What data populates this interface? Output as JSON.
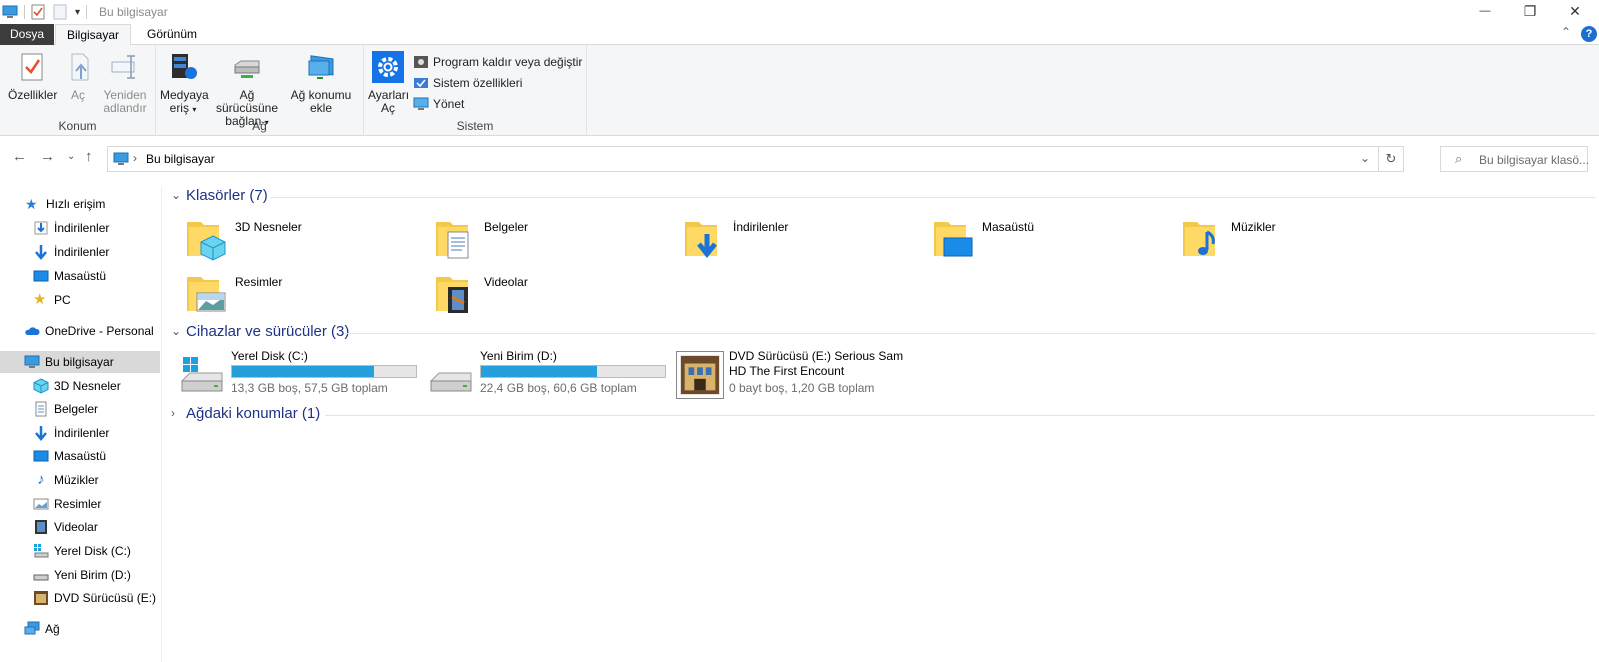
{
  "window": {
    "title": "Bu bilgisayar",
    "controls": {
      "minimize": "—",
      "restore": "❐",
      "close": "✕"
    }
  },
  "ribbon_tabs": [
    "Dosya",
    "Bilgisayar",
    "Görünüm"
  ],
  "ribbon": {
    "groups": {
      "konum": {
        "label": "Konum",
        "buttons": [
          "Özellikler",
          "Aç",
          "Yeniden",
          "adlandır"
        ]
      },
      "ag": {
        "label": "Ağ",
        "media_1": "Medyaya",
        "media_2": "eriş",
        "map_1": "Ağ sürücüsüne",
        "map_2": "bağlan",
        "addloc_1": "Ağ konumu",
        "addloc_2": "ekle"
      },
      "sistem": {
        "label": "Sistem",
        "settings_1": "Ayarları",
        "settings_2": "Aç",
        "uninstall": "Program kaldır veya değiştir",
        "properties": "Sistem özellikleri",
        "manage": "Yönet"
      }
    }
  },
  "address": {
    "breadcrumb": "Bu bilgisayar",
    "search_placeholder": "Bu bilgisayar klasö..."
  },
  "sidebar": {
    "items": [
      {
        "label": "Hızlı erişim",
        "icon": "star-icon"
      },
      {
        "label": "İndirilenler",
        "icon": "download-icon"
      },
      {
        "label": "İndirilenler",
        "icon": "download-icon"
      },
      {
        "label": "Masaüstü",
        "icon": "desktop-icon"
      },
      {
        "label": "PC",
        "icon": "star-icon"
      },
      {
        "label": "OneDrive - Personal",
        "icon": "cloud-icon"
      },
      {
        "label": "Bu bilgisayar",
        "icon": "computer-icon"
      },
      {
        "label": "3D Nesneler",
        "icon": "cube-icon"
      },
      {
        "label": "Belgeler",
        "icon": "document-icon"
      },
      {
        "label": "İndirilenler",
        "icon": "download-icon"
      },
      {
        "label": "Masaüstü",
        "icon": "desktop-icon"
      },
      {
        "label": "Müzikler",
        "icon": "music-icon"
      },
      {
        "label": "Resimler",
        "icon": "picture-icon"
      },
      {
        "label": "Videolar",
        "icon": "video-icon"
      },
      {
        "label": "Yerel Disk (C:)",
        "icon": "drive-icon"
      },
      {
        "label": "Yeni Birim (D:)",
        "icon": "drive-icon"
      },
      {
        "label": "DVD Sürücüsü (E:) Se",
        "icon": "dvd-icon"
      },
      {
        "label": "Ağ",
        "icon": "network-icon"
      }
    ]
  },
  "sections": {
    "folders_title": "Klasörler (7)",
    "devices_title": "Cihazlar ve sürücüler (3)",
    "network_title": "Ağdaki konumlar (1)"
  },
  "folders": [
    "3D Nesneler",
    "Belgeler",
    "İndirilenler",
    "Masaüstü",
    "Müzikler",
    "Resimler",
    "Videolar"
  ],
  "drives": [
    {
      "name": "Yerel Disk (C:)",
      "info": "13,3 GB boş, 57,5 GB toplam",
      "used_fraction": 0.77
    },
    {
      "name": "Yeni Birim (D:)",
      "info": "22,4 GB boş, 60,6 GB toplam",
      "used_fraction": 0.63
    },
    {
      "name": "DVD Sürücüsü (E:) Serious Sam HD The First Encount",
      "info": "0 bayt boş, 1,20 GB toplam"
    }
  ],
  "colors": {
    "accent": "#1e3287",
    "bar": "#26a0da",
    "selected": "#d9d9d9"
  }
}
